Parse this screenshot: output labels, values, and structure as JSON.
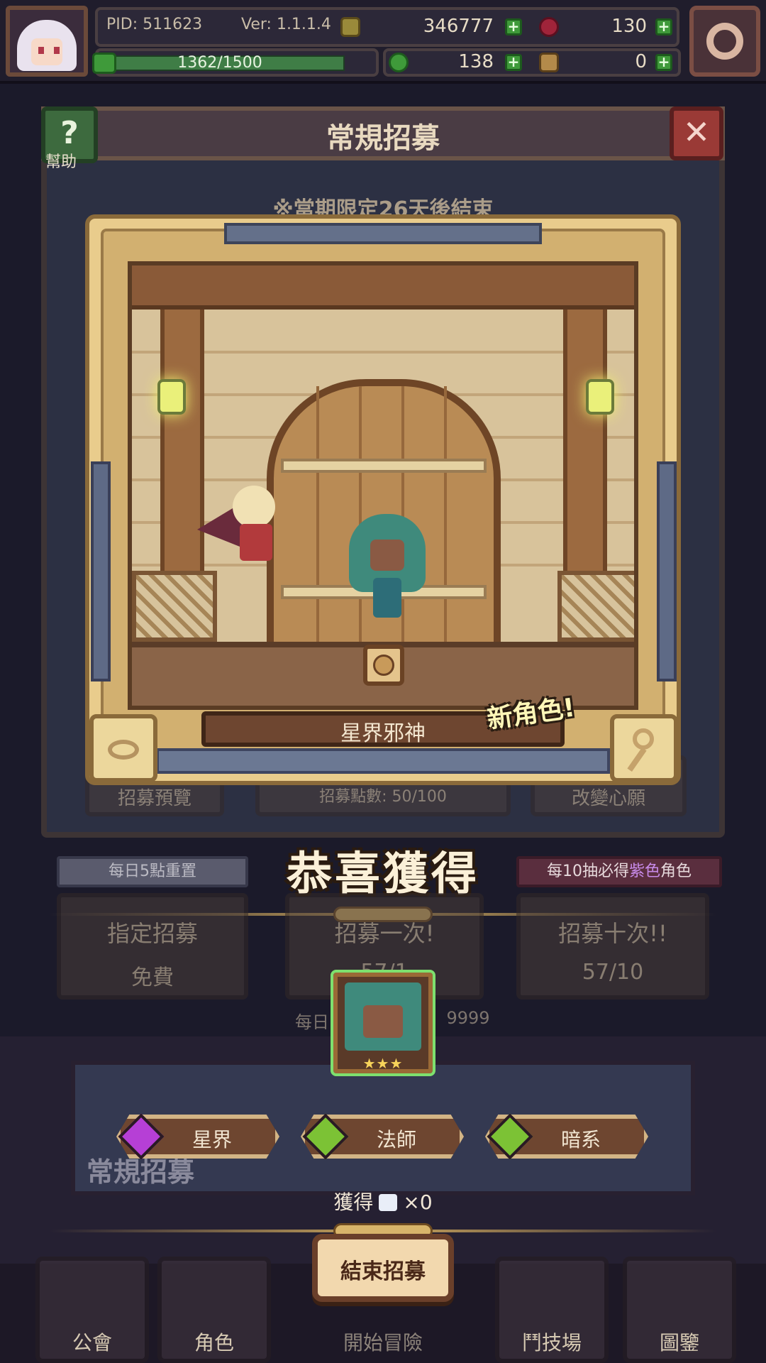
{
  "hud": {
    "pid": "PID: 511623",
    "version": "Ver: 1.1.1.4",
    "gold": "346777",
    "gem": "130",
    "xp": "1362/1500",
    "clover": "138",
    "ticket": "0"
  },
  "header": {
    "title": "常規招募",
    "help_label": "幫助",
    "help_symbol": "?",
    "close_symbol": "✕"
  },
  "limited_notice": "※當期限定26天後結束",
  "result": {
    "character_name": "星界邪神",
    "new_tag": "新角色!",
    "congrats": "恭喜獲得",
    "stars": "★★★",
    "tags": [
      {
        "label": "星界",
        "color": "#b63fd6"
      },
      {
        "label": "法師",
        "color": "#7cc235"
      },
      {
        "label": "暗系",
        "color": "#7cc235"
      }
    ],
    "obtain_prefix": "獲得",
    "obtain_count": "×0"
  },
  "behind": {
    "preview": "招募預覽",
    "points": "招募點數: 50/100",
    "change_wish": "改變心願",
    "daily_reset": "每日5點重置",
    "purple_hint_a": "每10抽必得",
    "purple_hint_b": "紫色",
    "purple_hint_c": "角色",
    "designated": "指定招募",
    "free": "免費",
    "once": "招募一次!",
    "once_cost": "57/1",
    "ten": "招募十次!!",
    "ten_cost": "57/10",
    "daily_limit": "每日",
    "limit_value": "9999",
    "banner": "常規招募"
  },
  "actions": {
    "end_label": "結束招募"
  },
  "nav": [
    {
      "label": "公會"
    },
    {
      "label": "角色"
    },
    {
      "label": "開始冒險"
    },
    {
      "label": "鬥技場"
    },
    {
      "label": "圖鑒"
    }
  ]
}
